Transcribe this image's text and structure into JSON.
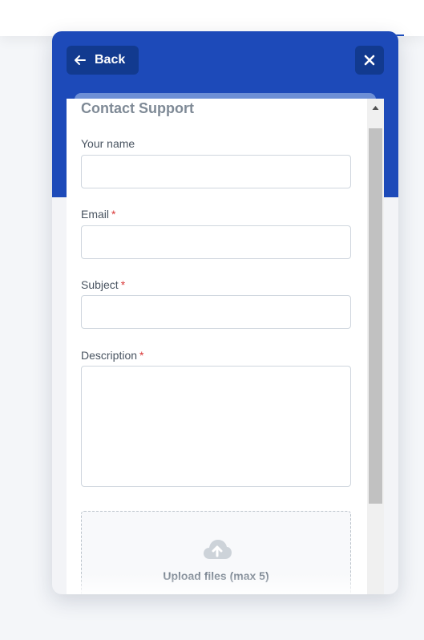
{
  "nav": {
    "back_label": "Back"
  },
  "form": {
    "title": "Contact Support",
    "fields": {
      "name": {
        "label": "Your name",
        "value": "",
        "required_mark": ""
      },
      "email": {
        "label": "Email",
        "value": "",
        "required_mark": "*"
      },
      "subject": {
        "label": "Subject",
        "value": "",
        "required_mark": "*"
      },
      "description": {
        "label": "Description",
        "value": "",
        "required_mark": "*"
      }
    },
    "upload": {
      "label": "Upload files (max 5)"
    }
  },
  "colors": {
    "header": "#1d4ab9",
    "button_bg": "#123a8f",
    "required": "#d93838"
  },
  "icons": {
    "back": "arrow-left-icon",
    "close": "close-icon",
    "upload": "cloud-upload-icon",
    "scroll_up": "triangle-up-icon"
  }
}
